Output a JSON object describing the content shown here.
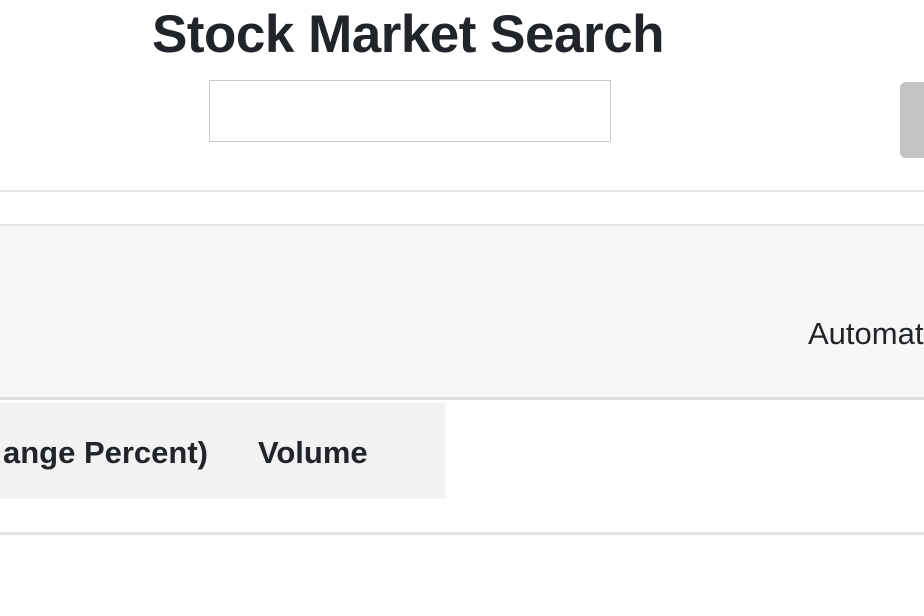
{
  "header": {
    "title": "Stock Market Search",
    "search_value": "",
    "search_placeholder": ""
  },
  "panel": {
    "text": "Automat"
  },
  "table": {
    "columns": [
      "ange Percent)",
      "Volume"
    ]
  },
  "colors": {
    "text": "#212529",
    "panel_bg": "#f7f7f7",
    "header_bg": "#f2f2f2",
    "button_bg": "#c4c4c4"
  }
}
